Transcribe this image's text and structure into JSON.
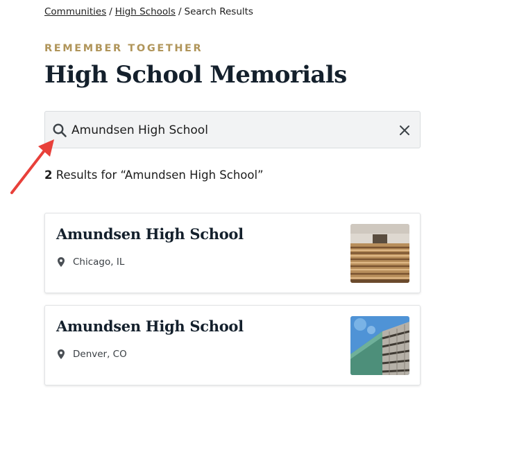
{
  "breadcrumb": {
    "items": [
      {
        "label": "Communities",
        "link": true
      },
      {
        "label": "High Schools",
        "link": true
      },
      {
        "label": "Search Results",
        "link": false
      }
    ],
    "separator": "/"
  },
  "eyebrow": "REMEMBER TOGETHER",
  "page_title": "High School Memorials",
  "search": {
    "value": "Amundsen High School",
    "icon": "search-icon",
    "clear_icon": "close-icon"
  },
  "results_summary": {
    "count": "2",
    "text": " Results for “Amundsen High School”"
  },
  "results": [
    {
      "name": "Amundsen High School",
      "location": "Chicago, IL",
      "location_icon": "map-pin-icon",
      "image": "auditorium-seats-photo"
    },
    {
      "name": "Amundsen High School",
      "location": "Denver, CO",
      "location_icon": "map-pin-icon",
      "image": "modern-building-photo"
    }
  ],
  "colors": {
    "eyebrow": "#b0955a",
    "title": "#14202c",
    "search_bg": "#f2f3f4",
    "annotation_arrow": "#e8403a"
  }
}
